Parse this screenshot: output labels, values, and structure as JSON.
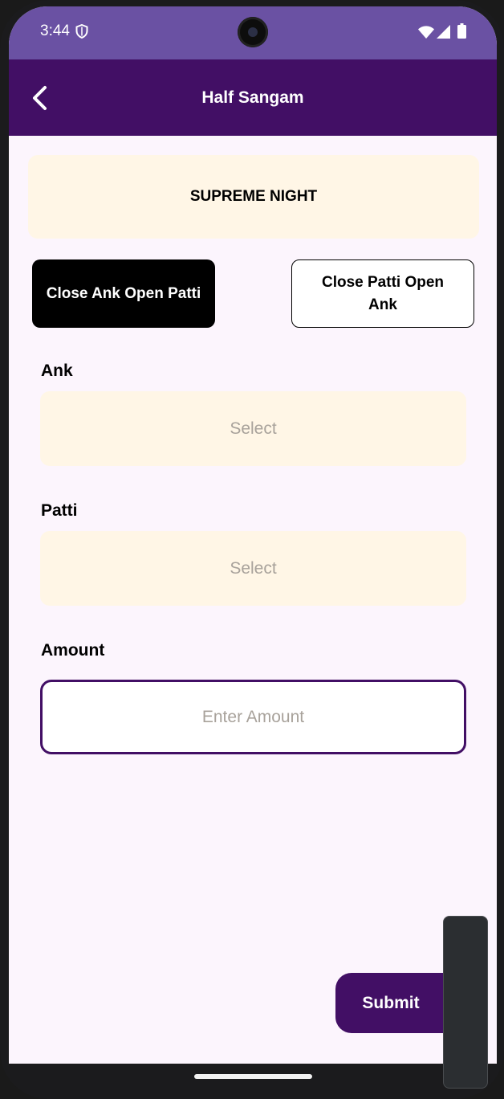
{
  "status_bar": {
    "time": "3:44",
    "icons": [
      "shield-icon",
      "wifi-icon",
      "signal-icon",
      "battery-icon"
    ]
  },
  "app_bar": {
    "title": "Half Sangam",
    "back_icon": "chevron-left-icon"
  },
  "game": {
    "name": "SUPREME NIGHT"
  },
  "modes": {
    "active_label": "Close Ank Open Patti",
    "inactive_label": "Close Patti Open Ank"
  },
  "form": {
    "ank_label": "Ank",
    "ank_placeholder": "Select",
    "patti_label": "Patti",
    "patti_placeholder": "Select",
    "amount_label": "Amount",
    "amount_placeholder": "Enter Amount"
  },
  "submit_label": "Submit",
  "colors": {
    "status_bar": "#6a51a3",
    "app_bar": "#420f65",
    "card_bg": "#fff6e6",
    "page_bg": "#fcf5fd",
    "accent": "#420f65"
  }
}
